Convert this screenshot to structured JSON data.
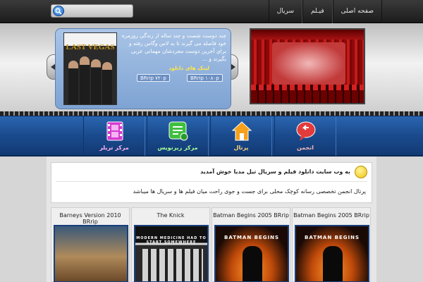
{
  "topbar": {
    "search": {
      "placeholder": "",
      "value": ""
    },
    "nav": [
      "صفحه اصلی",
      "فیـلم",
      "سریال"
    ]
  },
  "slider": {
    "poster_title": "LAST VEGAS",
    "description": "چند دوست شصت و چند ساله از زندگی روزمره خود فاصله می گیرند تا به لاس وگاس رفته و برای آخرین دوست مجردشان مهمانی عزبی بگیرند و ...",
    "links_title": "لینک های دانلود",
    "link_1080": "BRrip ۱۰۸۰p",
    "link_720": "BRrip ۷۲۰p"
  },
  "menu": [
    {
      "label": "انجمن",
      "icon": "chat-back-icon"
    },
    {
      "label": "پرتال",
      "icon": "home-icon"
    },
    {
      "label": "مرکز زیرنویس",
      "icon": "subtitle-icon"
    },
    {
      "label": "مرکز تریلر",
      "icon": "film-icon"
    }
  ],
  "welcome": {
    "title": "به وب سایت دانلود فیلم و سریال تیل مدیا خوش آمدید",
    "text": "پرتال انجمن تخصصی رسانه کوچک محلی برای جست و جوی راحت میان فیلم ها و سریال ها میباشد ￼"
  },
  "cards": [
    {
      "title": "Barneys Version 2010 BRrip"
    },
    {
      "title": "The Knick",
      "poster_text": "MODERN MEDICINE HAD TO START SOMEWHERE"
    },
    {
      "title": "Batman Begins 2005 BRrip",
      "poster_text": "BATMAN BEGINS"
    },
    {
      "title": "Batman Begins 2005 BRrip",
      "poster_text": "BATMAN BEGINS"
    }
  ],
  "colors": {
    "menu_blue": "#1a4a8d",
    "topbar": "#2a2a2a"
  }
}
